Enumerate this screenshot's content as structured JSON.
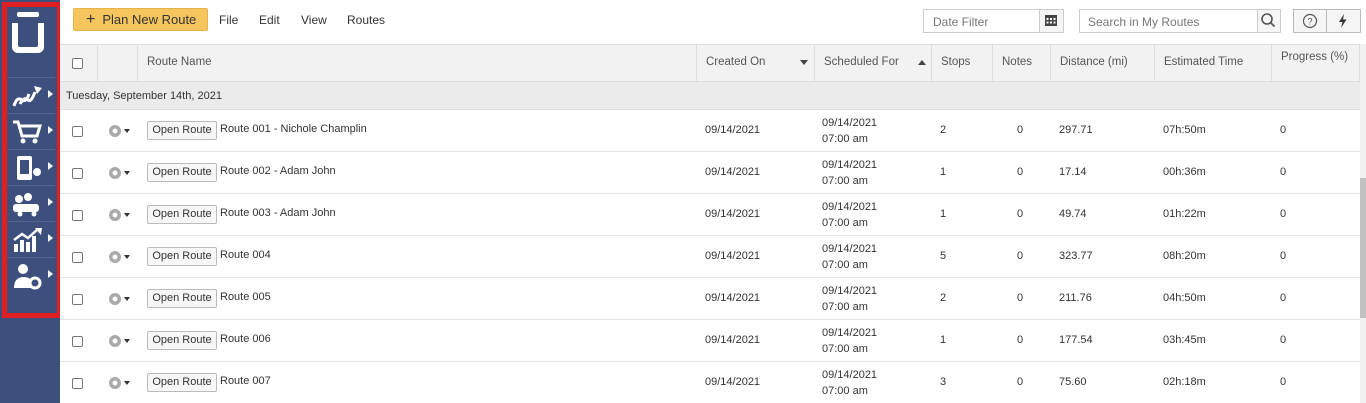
{
  "toolbar": {
    "plan_label": "Plan New Route",
    "menu": [
      "File",
      "Edit",
      "View",
      "Routes"
    ],
    "date_filter_placeholder": "Date Filter",
    "search_placeholder": "Search in My Routes"
  },
  "sidebar": {
    "items": [
      {
        "icon": "routes-icon"
      },
      {
        "icon": "cart-icon"
      },
      {
        "icon": "mobile-location-icon"
      },
      {
        "icon": "fleet-icon"
      },
      {
        "icon": "analytics-icon"
      },
      {
        "icon": "user-settings-icon"
      }
    ]
  },
  "table": {
    "columns": {
      "route_name": "Route Name",
      "created_on": "Created On",
      "scheduled_for": "Scheduled For",
      "stops": "Stops",
      "notes": "Notes",
      "distance": "Distance (mi)",
      "estimated_time": "Estimated Time",
      "progress": "Progress (%)"
    },
    "group_label": "Tuesday, September 14th, 2021",
    "open_label": "Open Route",
    "rows": [
      {
        "name": "Route 001 - Nichole Champlin",
        "created": "09/14/2021",
        "sched_date": "09/14/2021",
        "sched_time": "07:00 am",
        "stops": "2",
        "notes": "0",
        "distance": "297.71",
        "time": "07h:50m",
        "progress": "0"
      },
      {
        "name": "Route 002 - Adam John",
        "created": "09/14/2021",
        "sched_date": "09/14/2021",
        "sched_time": "07:00 am",
        "stops": "1",
        "notes": "0",
        "distance": "17.14",
        "time": "00h:36m",
        "progress": "0"
      },
      {
        "name": "Route 003 - Adam John",
        "created": "09/14/2021",
        "sched_date": "09/14/2021",
        "sched_time": "07:00 am",
        "stops": "1",
        "notes": "0",
        "distance": "49.74",
        "time": "01h:22m",
        "progress": "0"
      },
      {
        "name": "Route 004",
        "created": "09/14/2021",
        "sched_date": "09/14/2021",
        "sched_time": "07:00 am",
        "stops": "5",
        "notes": "0",
        "distance": "323.77",
        "time": "08h:20m",
        "progress": "0"
      },
      {
        "name": "Route 005",
        "created": "09/14/2021",
        "sched_date": "09/14/2021",
        "sched_time": "07:00 am",
        "stops": "2",
        "notes": "0",
        "distance": "211.76",
        "time": "04h:50m",
        "progress": "0"
      },
      {
        "name": "Route 006",
        "created": "09/14/2021",
        "sched_date": "09/14/2021",
        "sched_time": "07:00 am",
        "stops": "1",
        "notes": "0",
        "distance": "177.54",
        "time": "03h:45m",
        "progress": "0"
      },
      {
        "name": "Route 007",
        "created": "09/14/2021",
        "sched_date": "09/14/2021",
        "sched_time": "07:00 am",
        "stops": "3",
        "notes": "0",
        "distance": "75.60",
        "time": "02h:18m",
        "progress": "0"
      }
    ]
  },
  "colors": {
    "sidebar": "#3d4f7c",
    "highlight_frame": "#e02020",
    "primary_button": "#f6c55e"
  }
}
